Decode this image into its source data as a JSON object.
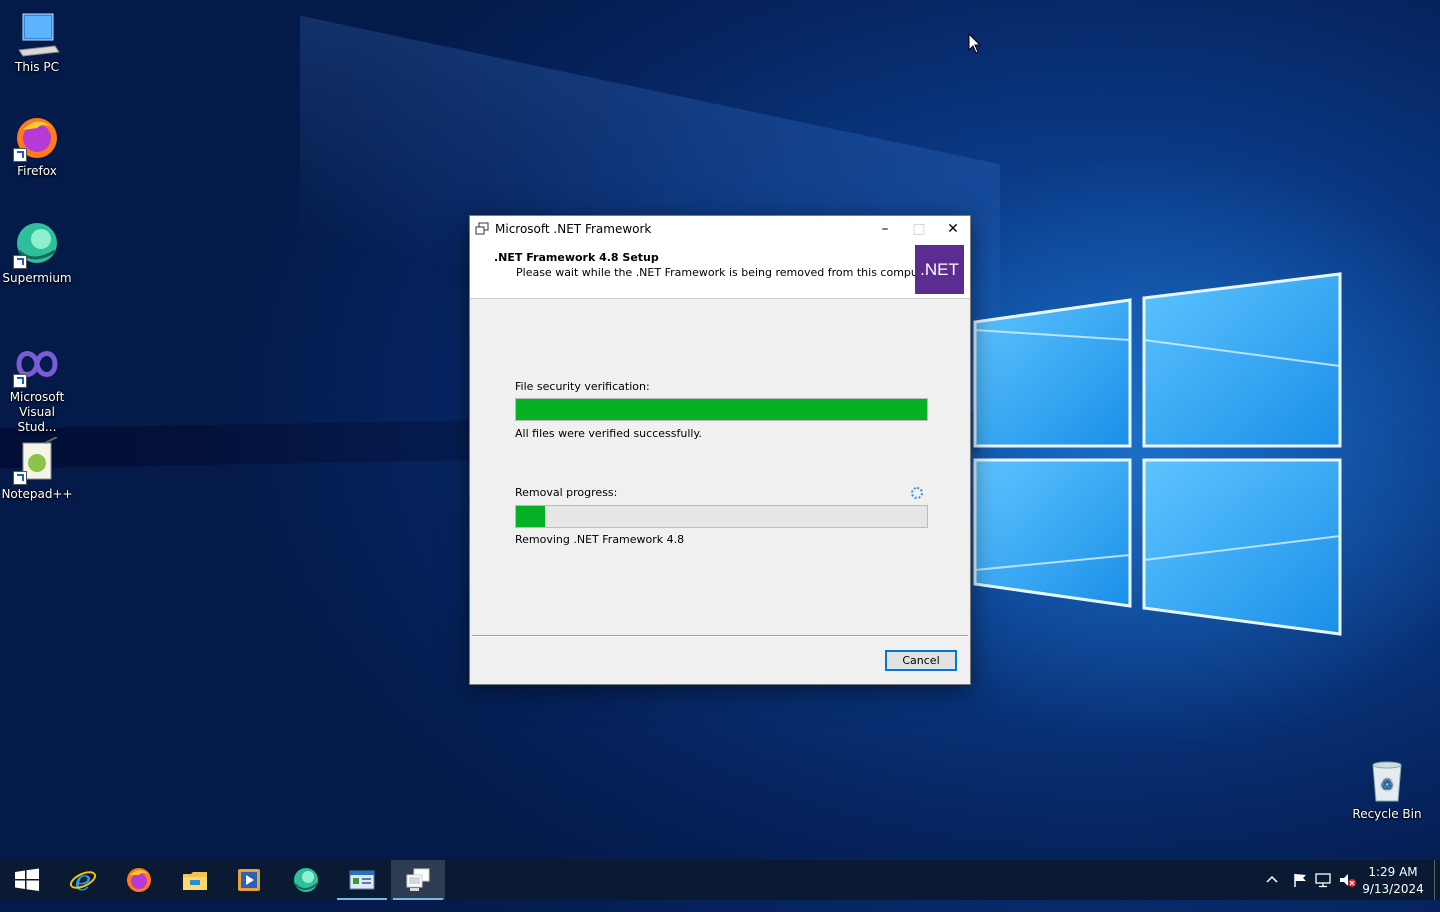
{
  "desktop": {
    "icons": [
      {
        "label": "This PC"
      },
      {
        "label": "Firefox"
      },
      {
        "label": "Supermium"
      },
      {
        "label": "Microsoft Visual Stud..."
      },
      {
        "label": "Notepad++"
      },
      {
        "label": "Recycle Bin"
      }
    ]
  },
  "dialog": {
    "title": "Microsoft .NET Framework",
    "heading": ".NET Framework 4.8 Setup",
    "subheading": "Please wait while the .NET Framework is being removed from this computer.",
    "logo_text": ".NET",
    "verification": {
      "label": "File security verification:",
      "progress_percent": 100,
      "status": "All files were verified successfully."
    },
    "removal": {
      "label": "Removal progress:",
      "progress_percent": 7,
      "status": "Removing .NET Framework 4.8"
    },
    "cancel_label": "Cancel",
    "colors": {
      "progress": "#06b025",
      "net_logo": "#5c2d91"
    }
  },
  "taskbar": {
    "items": [
      {
        "name": "start-button",
        "icon": "windows-logo-icon"
      },
      {
        "name": "internet-explorer",
        "icon": "internet-explorer-icon"
      },
      {
        "name": "firefox",
        "icon": "firefox-icon"
      },
      {
        "name": "file-explorer",
        "icon": "folder-icon"
      },
      {
        "name": "media-player",
        "icon": "media-player-icon"
      },
      {
        "name": "supermium",
        "icon": "supermium-icon"
      },
      {
        "name": "control-panel",
        "icon": "control-panel-icon"
      },
      {
        "name": "net-setup",
        "icon": "setup-icon"
      }
    ],
    "clock": {
      "time": "1:29 AM",
      "date": "9/13/2024"
    }
  }
}
